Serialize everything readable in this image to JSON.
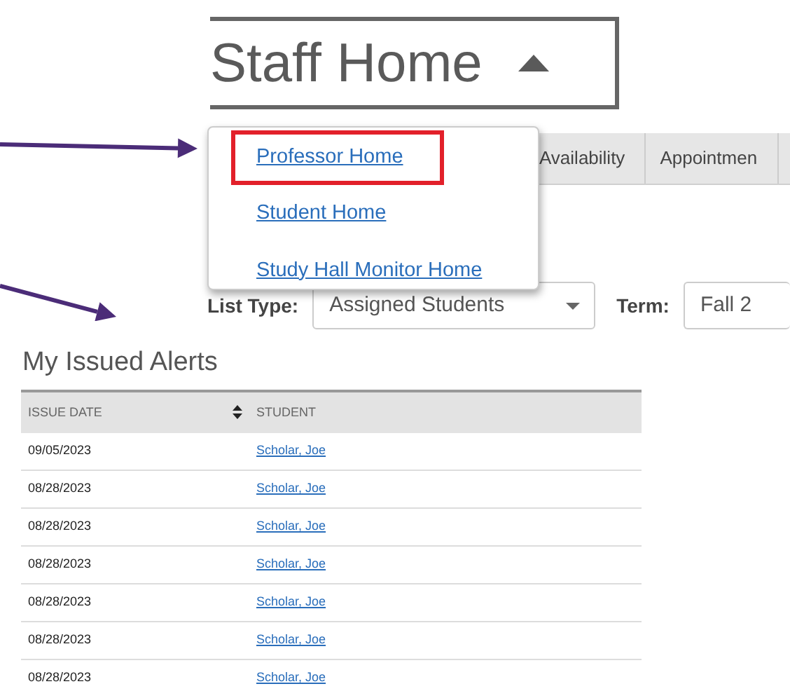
{
  "title": {
    "text": "Staff Home",
    "expanded": true
  },
  "tabs": [
    {
      "label": "Availability",
      "selected": false
    },
    {
      "label": "Appointmen",
      "selected": false
    }
  ],
  "menu": {
    "items": [
      {
        "label": "Professor Home",
        "highlighted": true
      },
      {
        "label": "Student Home",
        "highlighted": false
      },
      {
        "label": "Study Hall Monitor Home",
        "highlighted": false
      }
    ]
  },
  "filters": [
    {
      "label": "List Type:",
      "value": "Assigned Students",
      "kind": "full"
    },
    {
      "label": "Term:",
      "value": "Fall 2",
      "kind": "cut"
    }
  ],
  "alerts": {
    "title": "My Issued Alerts",
    "columns": [
      {
        "label": "ISSUE DATE",
        "sortable": true
      },
      {
        "label": "STUDENT",
        "sortable": false
      }
    ],
    "rows": [
      {
        "issue_date": "09/05/2023",
        "student": "Scholar, Joe"
      },
      {
        "issue_date": "08/28/2023",
        "student": "Scholar, Joe"
      },
      {
        "issue_date": "08/28/2023",
        "student": "Scholar, Joe"
      },
      {
        "issue_date": "08/28/2023",
        "student": "Scholar, Joe"
      },
      {
        "issue_date": "08/28/2023",
        "student": "Scholar, Joe"
      },
      {
        "issue_date": "08/28/2023",
        "student": "Scholar, Joe"
      },
      {
        "issue_date": "08/28/2023",
        "student": "Scholar, Joe"
      }
    ]
  }
}
